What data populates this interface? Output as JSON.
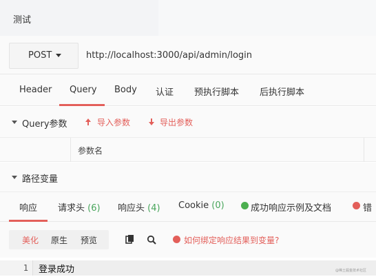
{
  "window": {
    "title": "测试"
  },
  "request": {
    "method": "POST",
    "url": "http://localhost:3000/api/admin/login"
  },
  "request_tabs": [
    {
      "label": "Header",
      "active": false
    },
    {
      "label": "Query",
      "active": true
    },
    {
      "label": "Body",
      "active": false
    },
    {
      "label": "认证",
      "active": false
    },
    {
      "label": "预执行脚本",
      "active": false
    },
    {
      "label": "后执行脚本",
      "active": false
    }
  ],
  "query_params": {
    "section_label": "Query参数",
    "import_label": "导入参数",
    "export_label": "导出参数",
    "column_name": "参数名"
  },
  "path_vars": {
    "section_label": "路径变量"
  },
  "response_tabs": {
    "response": "响应",
    "request_headers": "请求头",
    "request_headers_count": "(6)",
    "response_headers": "响应头",
    "response_headers_count": "(4)",
    "cookie": "Cookie",
    "cookie_count": "(0)",
    "success_example": "成功响应示例及文档",
    "error_example": "错"
  },
  "format_bar": {
    "beautify": "美化",
    "raw": "原生",
    "preview": "预览",
    "bind_help": "如何绑定响应结果到变量?"
  },
  "response_body": {
    "line_number": "1",
    "content": "登录成功"
  },
  "watermark": "@稀土掘金技术社区",
  "colors": {
    "accent": "#e35f5a",
    "count": "#48a55b",
    "success": "#4caf50"
  }
}
